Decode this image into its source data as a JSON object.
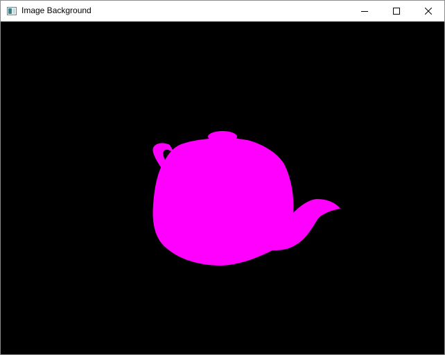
{
  "window": {
    "title": "Image Background",
    "icon": "window-app-icon",
    "controls": {
      "minimize_icon": "minimize-icon",
      "maximize_icon": "maximize-icon",
      "close_icon": "close-icon"
    }
  },
  "viewport": {
    "background_color": "#000000",
    "object": "teapot",
    "object_color": "#ff00ff"
  }
}
